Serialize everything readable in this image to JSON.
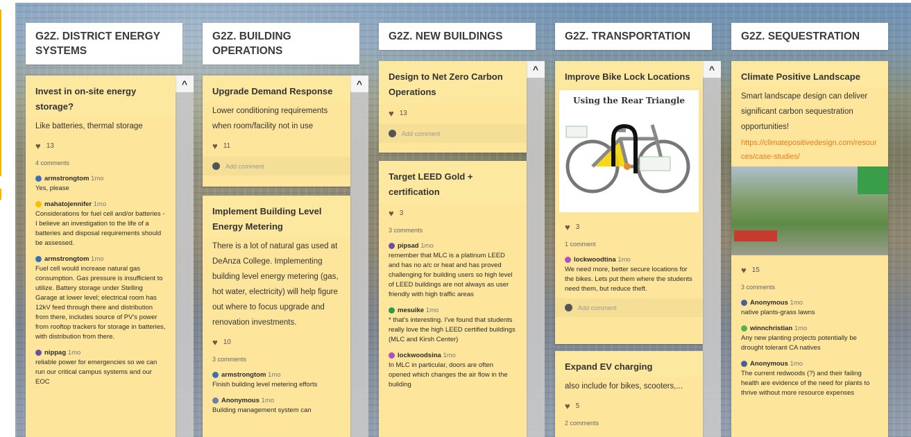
{
  "columns": [
    {
      "header": "G2Z. DISTRICT ENERGY SYSTEMS",
      "cards": [
        {
          "title": "Invest in on-site energy storage?",
          "desc": "Like batteries, thermal storage",
          "likes": "13",
          "comments_count": "4 comments",
          "comments": [
            {
              "author": "armstrongtom",
              "time": "1mo",
              "text": "Yes, please"
            },
            {
              "author": "mahatojennifer",
              "time": "1mo",
              "text": "Considerations for fuel cell and/or batteries - I believe an investigation to the life of a batteries and disposal requirements should be assessed."
            },
            {
              "author": "armstrongtom",
              "time": "1mo",
              "text": "Fuel cell would increase natural gas consumption. Gas pressure is insufficient to utilize. Battery storage under Stelling Garage at lower level; electrical room has 12kV feed through there and distribution from there, includes source of PV's power from rooftop trackers for storage in batteries, with distribution from there."
            },
            {
              "author": "nippag",
              "time": "1mo",
              "text": "reliable power for emergencies so we can run our critical campus systems and our EOC"
            }
          ]
        }
      ]
    },
    {
      "header": "G2Z. BUILDING OPERATIONS",
      "cards": [
        {
          "title": "Upgrade Demand Response",
          "desc": "Lower conditioning requirements when room/facility not in use",
          "likes": "11",
          "add_comment": "Add comment"
        },
        {
          "title": "Implement Building Level Energy Metering",
          "desc": "There is a lot of natural gas used at DeAnza College.  Implementing building level energy metering (gas, hot water, electricity) will help figure out where to focus upgrade and renovation investments.",
          "likes": "10",
          "comments_count": "3 comments",
          "comments": [
            {
              "author": "armstrongtom",
              "time": "1mo",
              "text": "Finish building level metering efforts"
            },
            {
              "author": "Anonymous",
              "time": "1mo",
              "text": "Building management system can"
            }
          ]
        }
      ]
    },
    {
      "header": "G2Z. NEW BUILDINGS",
      "cards": [
        {
          "title": "Design to Net Zero Carbon Operations",
          "likes": "13",
          "add_comment": "Add comment"
        },
        {
          "title": "Target LEED Gold + certification",
          "likes": "3",
          "comments_count": "3 comments",
          "comments": [
            {
              "author": "pipsad",
              "time": "1mo",
              "text": "remember that MLC is a platinum LEED and has no a/c or heat and has proved challenging for building users so high level of LEED buildings are not always as user friendly with high traffic areas"
            },
            {
              "author": "mesuike",
              "time": "1mo",
              "text": "* that's interesting. I've found that students really love the high LEED certified buildings (MLC and Kirsh Center)"
            },
            {
              "author": "lockwoodsina",
              "time": "1mo",
              "text": "In MLC in particular, doors are often opened which changes the air flow in the building"
            }
          ]
        }
      ]
    },
    {
      "header": "G2Z. TRANSPORTATION",
      "cards": [
        {
          "title": "Improve Bike Lock Locations",
          "image_caption": "Using the Rear Triangle",
          "likes": "3",
          "comments_count": "1 comment",
          "comments": [
            {
              "author": "lockwoodtina",
              "time": "1mo",
              "text": "We need more, better secure locations for the bikes. Lets put them where the students need them, but reduce theft."
            }
          ],
          "add_comment": "Add comment"
        },
        {
          "title": "Expand EV charging",
          "desc": "also include for bikes, scooters,...",
          "likes": "5",
          "comments_count": "2 comments"
        }
      ]
    },
    {
      "header": "G2Z. SEQUESTRATION",
      "cards": [
        {
          "title": "Climate Positive Landscape",
          "desc": "Smart landscape design can deliver significant carbon sequestration opportunities!",
          "link": "https://climatepositivedesign.com/resources/case-studies/",
          "likes": "15",
          "comments_count": "3 comments",
          "comments": [
            {
              "author": "Anonymous",
              "time": "1mo",
              "text": "native plants-grass lawns"
            },
            {
              "author": "winnchristian",
              "time": "1mo",
              "text": "Any new planting projects potentially be drought tolerant CA natives"
            },
            {
              "author": "Anonymous",
              "time": "1mo",
              "text": "The current redwoods (?) and their failing health are evidence of the need for plants to thrive without more resource expenses"
            }
          ]
        }
      ]
    }
  ],
  "colors": {
    "card": "#fde69c",
    "link": "#f07a1a",
    "header_bg": "#ffffff"
  }
}
